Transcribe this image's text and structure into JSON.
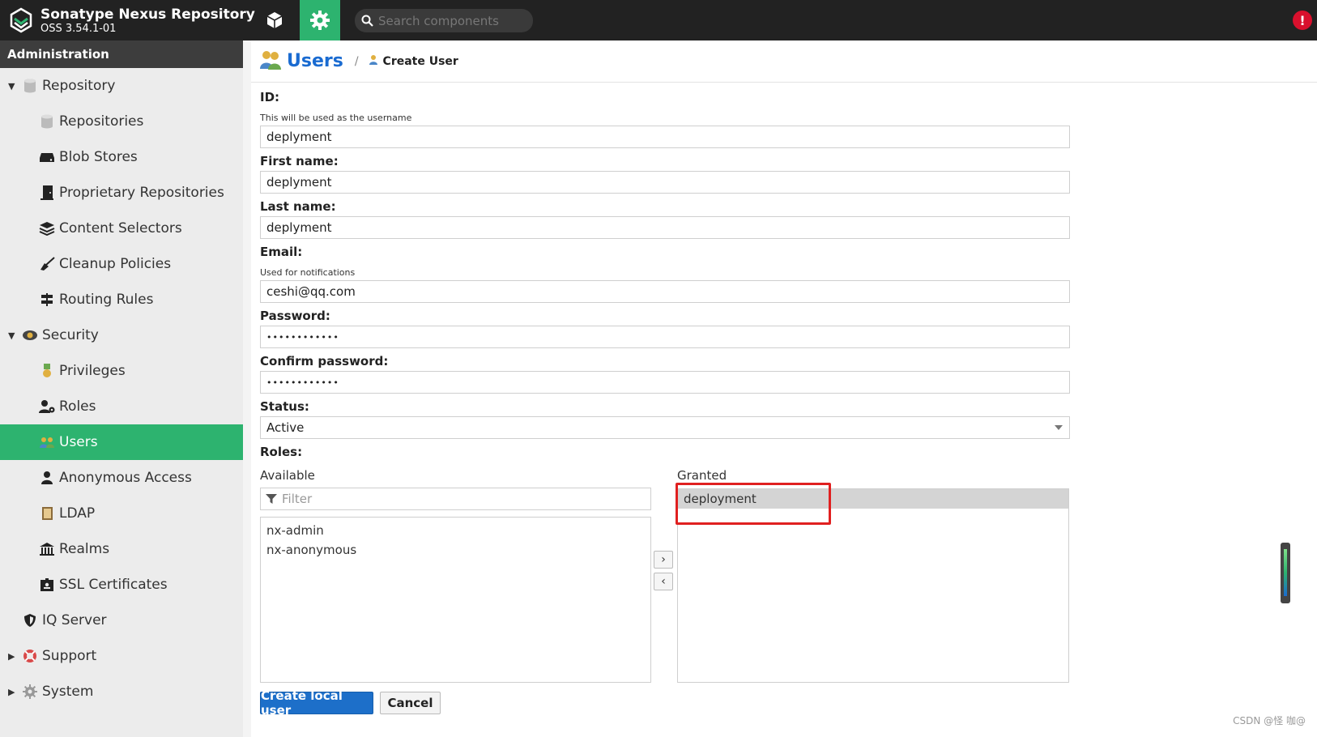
{
  "app": {
    "title": "Sonatype Nexus Repository",
    "version": "OSS 3.54.1-01",
    "search_placeholder": "Search components",
    "alert_glyph": "!"
  },
  "sidebar": {
    "header": "Administration",
    "items": [
      {
        "label": "Repository",
        "level": 1,
        "expanded": true,
        "icon": "database-icon"
      },
      {
        "label": "Repositories",
        "level": 2,
        "icon": "database-icon"
      },
      {
        "label": "Blob Stores",
        "level": 2,
        "icon": "hard-drive-icon"
      },
      {
        "label": "Proprietary Repositories",
        "level": 2,
        "icon": "door-icon"
      },
      {
        "label": "Content Selectors",
        "level": 2,
        "icon": "layers-icon"
      },
      {
        "label": "Cleanup Policies",
        "level": 2,
        "icon": "broom-icon"
      },
      {
        "label": "Routing Rules",
        "level": 2,
        "icon": "signpost-icon"
      },
      {
        "label": "Security",
        "level": 1,
        "expanded": true,
        "icon": "security-badge-icon"
      },
      {
        "label": "Privileges",
        "level": 2,
        "icon": "medal-icon"
      },
      {
        "label": "Roles",
        "level": 2,
        "icon": "user-gear-icon"
      },
      {
        "label": "Users",
        "level": 2,
        "icon": "users-icon",
        "active": true
      },
      {
        "label": "Anonymous Access",
        "level": 2,
        "icon": "user-icon"
      },
      {
        "label": "LDAP",
        "level": 2,
        "icon": "book-icon"
      },
      {
        "label": "Realms",
        "level": 2,
        "icon": "building-icon"
      },
      {
        "label": "SSL Certificates",
        "level": 2,
        "icon": "id-card-icon"
      },
      {
        "label": "IQ Server",
        "level": 1,
        "icon": "shield-icon"
      },
      {
        "label": "Support",
        "level": 1,
        "collapsed": true,
        "icon": "lifebuoy-icon"
      },
      {
        "label": "System",
        "level": 1,
        "collapsed": true,
        "icon": "gear-icon"
      }
    ]
  },
  "header": {
    "title": "Users",
    "separator": "/",
    "breadcrumb": "Create User"
  },
  "form": {
    "id_label": "ID:",
    "id_help": "This will be used as the username",
    "id_value": "deplyment",
    "first_name_label": "First name:",
    "first_name_value": "deplyment",
    "last_name_label": "Last name:",
    "last_name_value": "deplyment",
    "email_label": "Email:",
    "email_help": "Used for notifications",
    "email_value": "ceshi@qq.com",
    "password_label": "Password:",
    "password_value": "••••••••••••",
    "confirm_label": "Confirm password:",
    "confirm_value": "••••••••••••",
    "status_label": "Status:",
    "status_value": "Active",
    "roles_label": "Roles:",
    "available_label": "Available",
    "granted_label": "Granted",
    "filter_placeholder": "Filter",
    "available_roles": [
      "nx-admin",
      "nx-anonymous"
    ],
    "granted_roles": [
      "deployment"
    ],
    "move_right": "›",
    "move_left": "‹",
    "create_button": "Create local user",
    "cancel_button": "Cancel"
  },
  "watermark": "CSDN @怪 咖@",
  "colors": {
    "accent": "#2db36f",
    "topbar": "#222222",
    "link_blue": "#1a6bd1",
    "primary_button": "#1d6fc9",
    "highlight": "#e02020"
  }
}
